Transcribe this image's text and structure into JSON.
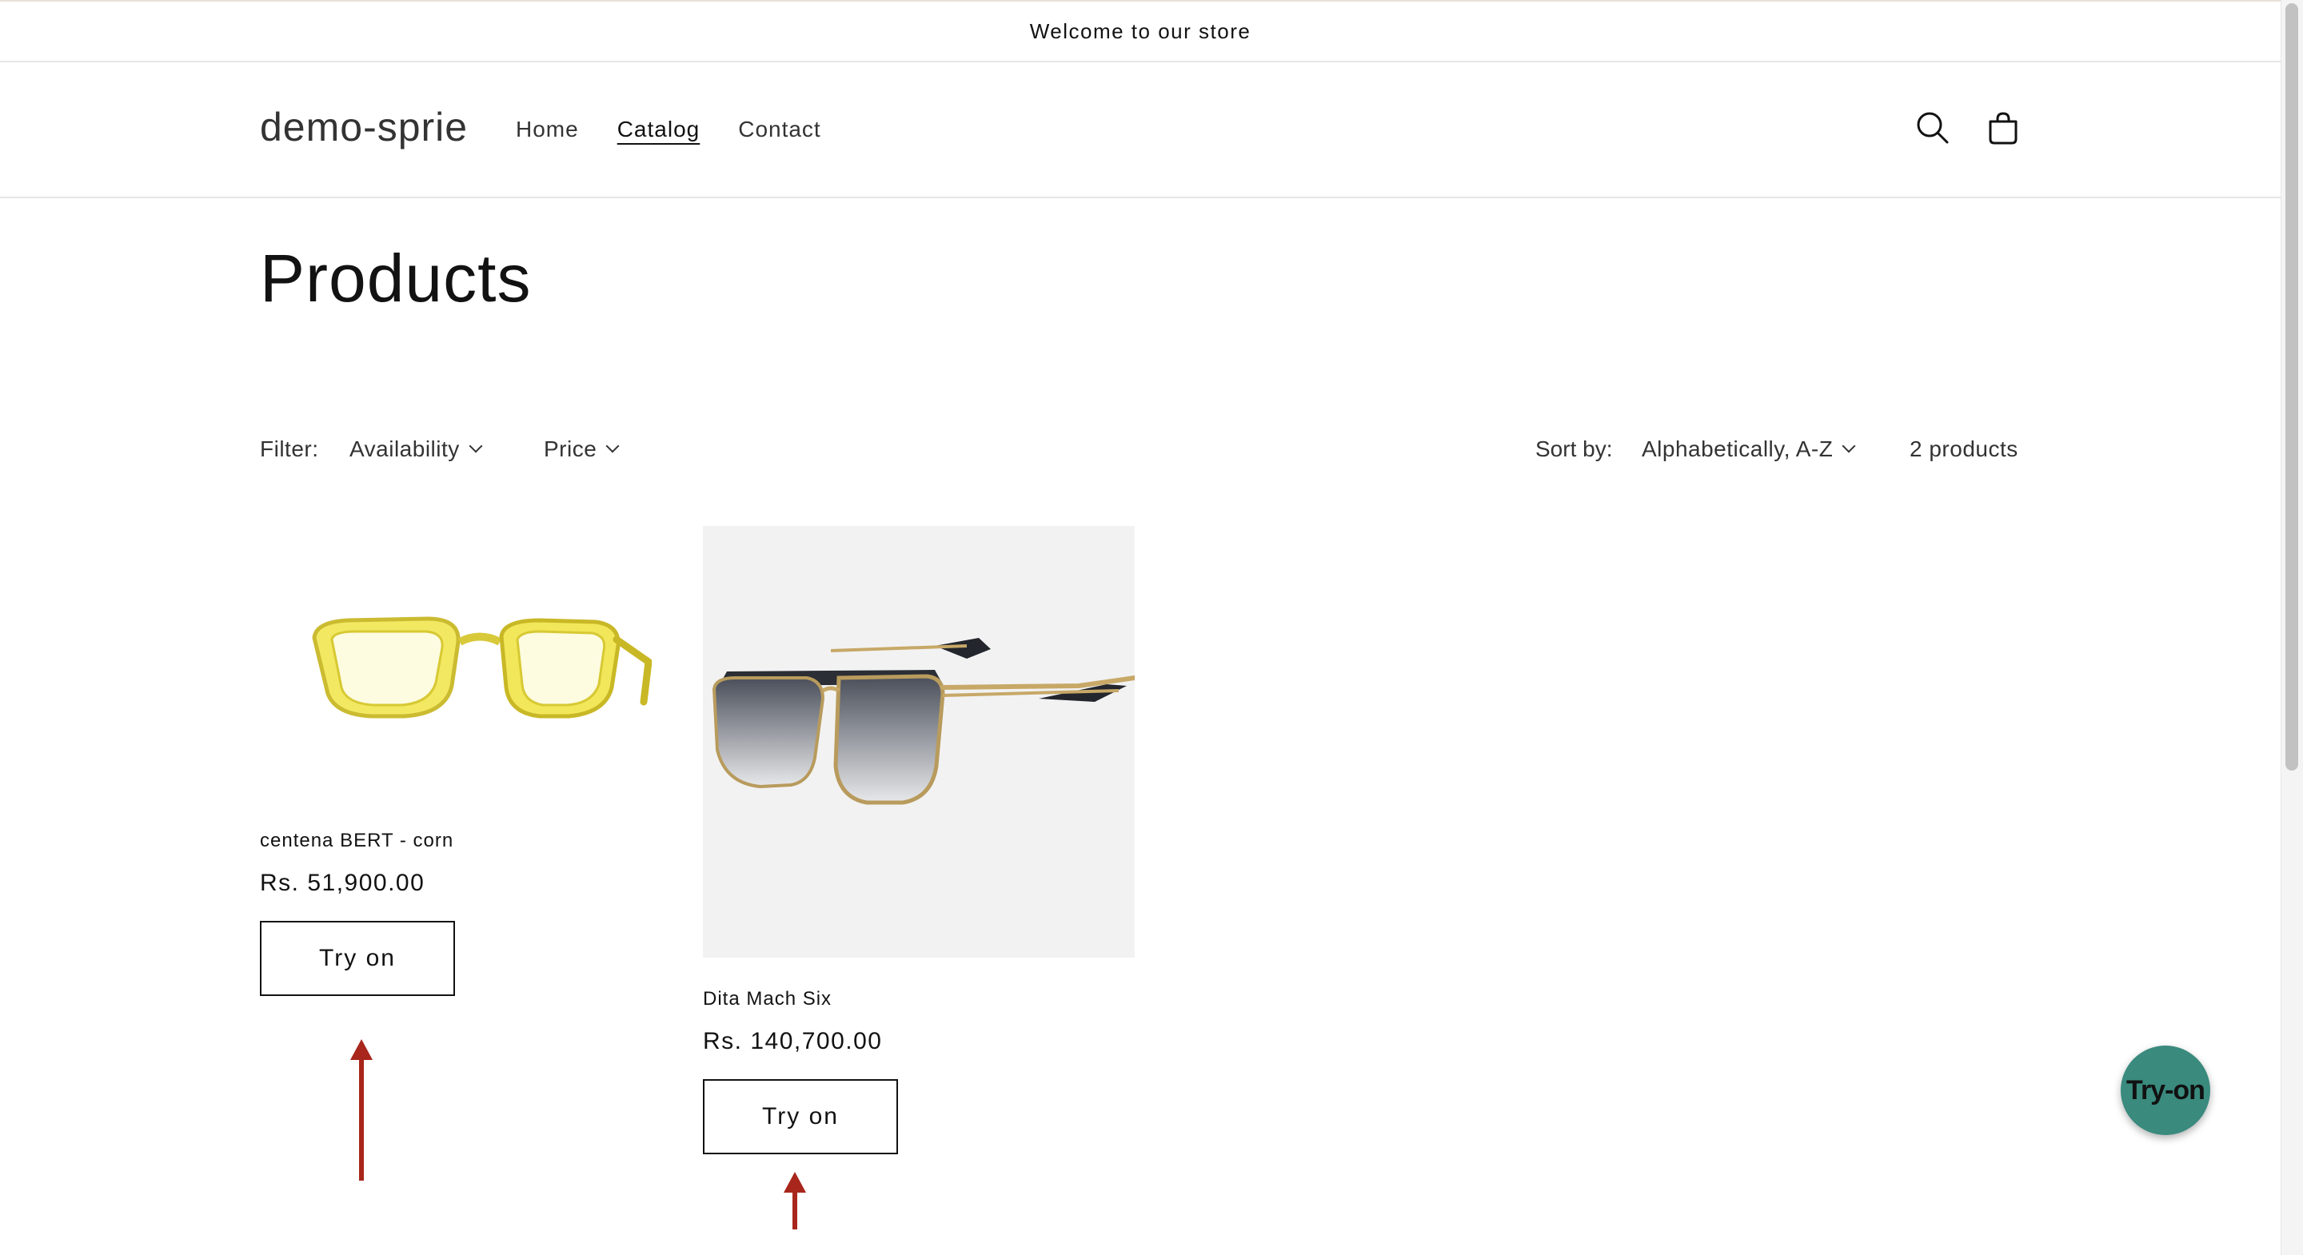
{
  "announcement": {
    "text": "Welcome to our store"
  },
  "header": {
    "logo": "demo-sprie",
    "nav": [
      {
        "label": "Home",
        "active": false
      },
      {
        "label": "Catalog",
        "active": true
      },
      {
        "label": "Contact",
        "active": false
      }
    ],
    "icons": [
      "search-icon",
      "cart-icon"
    ]
  },
  "main": {
    "title": "Products",
    "filter": {
      "label": "Filter:",
      "availability": "Availability",
      "price": "Price"
    },
    "sort": {
      "label": "Sort by:",
      "selected": "Alphabetically, A-Z"
    },
    "count": "2 products",
    "products": [
      {
        "title": "centena BERT - corn",
        "price": "Rs. 51,900.00",
        "button": "Try on"
      },
      {
        "title": "Dita Mach Six",
        "price": "Rs. 140,700.00",
        "button": "Try on"
      }
    ]
  },
  "fab": {
    "label": "Try-on"
  },
  "colors": {
    "text": "#121212",
    "arrow": "#a8261b",
    "fab": "#3a8a7e",
    "media_bg": "#f2f2f2"
  }
}
